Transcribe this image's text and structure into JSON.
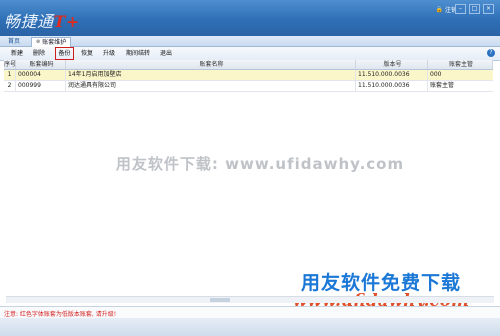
{
  "app": {
    "logo_text": "畅捷通",
    "logo_suffix": "T+",
    "logout_label": "注销",
    "window_min": "–",
    "window_max": "□",
    "window_close": "×"
  },
  "tabs": [
    {
      "label": "首页"
    },
    {
      "label": "账套维护"
    }
  ],
  "toolbar": {
    "buttons": [
      "新建",
      "删除",
      "备份",
      "恢复",
      "升级",
      "期间结转",
      "退出"
    ],
    "help_glyph": "?"
  },
  "table": {
    "headers": [
      "序号",
      "账套编码",
      "账套名称",
      "版本号",
      "账套主管"
    ],
    "rows": [
      [
        "1",
        "000004",
        "14年1月启用加壁店",
        "11.510.000.0036",
        "000"
      ],
      [
        "2",
        "000999",
        "润达通具有限公司",
        "11.510.000.0036",
        "账套主管"
      ]
    ]
  },
  "watermark": {
    "center": "用友软件下载: www.ufidawhy.com",
    "logo_line1": "用友软件免费下载",
    "logo_line2": "www.ufidawhy.com"
  },
  "status": {
    "message": "注意: 红色字体账套为低版本账套, 请升级!"
  },
  "colors": {
    "header_blue": "#2f6fb6",
    "selected_row": "#fbf6c9",
    "highlight_red": "#d01c1c",
    "logo_blue": "#1b78d6",
    "logo_orange": "#e0502b"
  }
}
